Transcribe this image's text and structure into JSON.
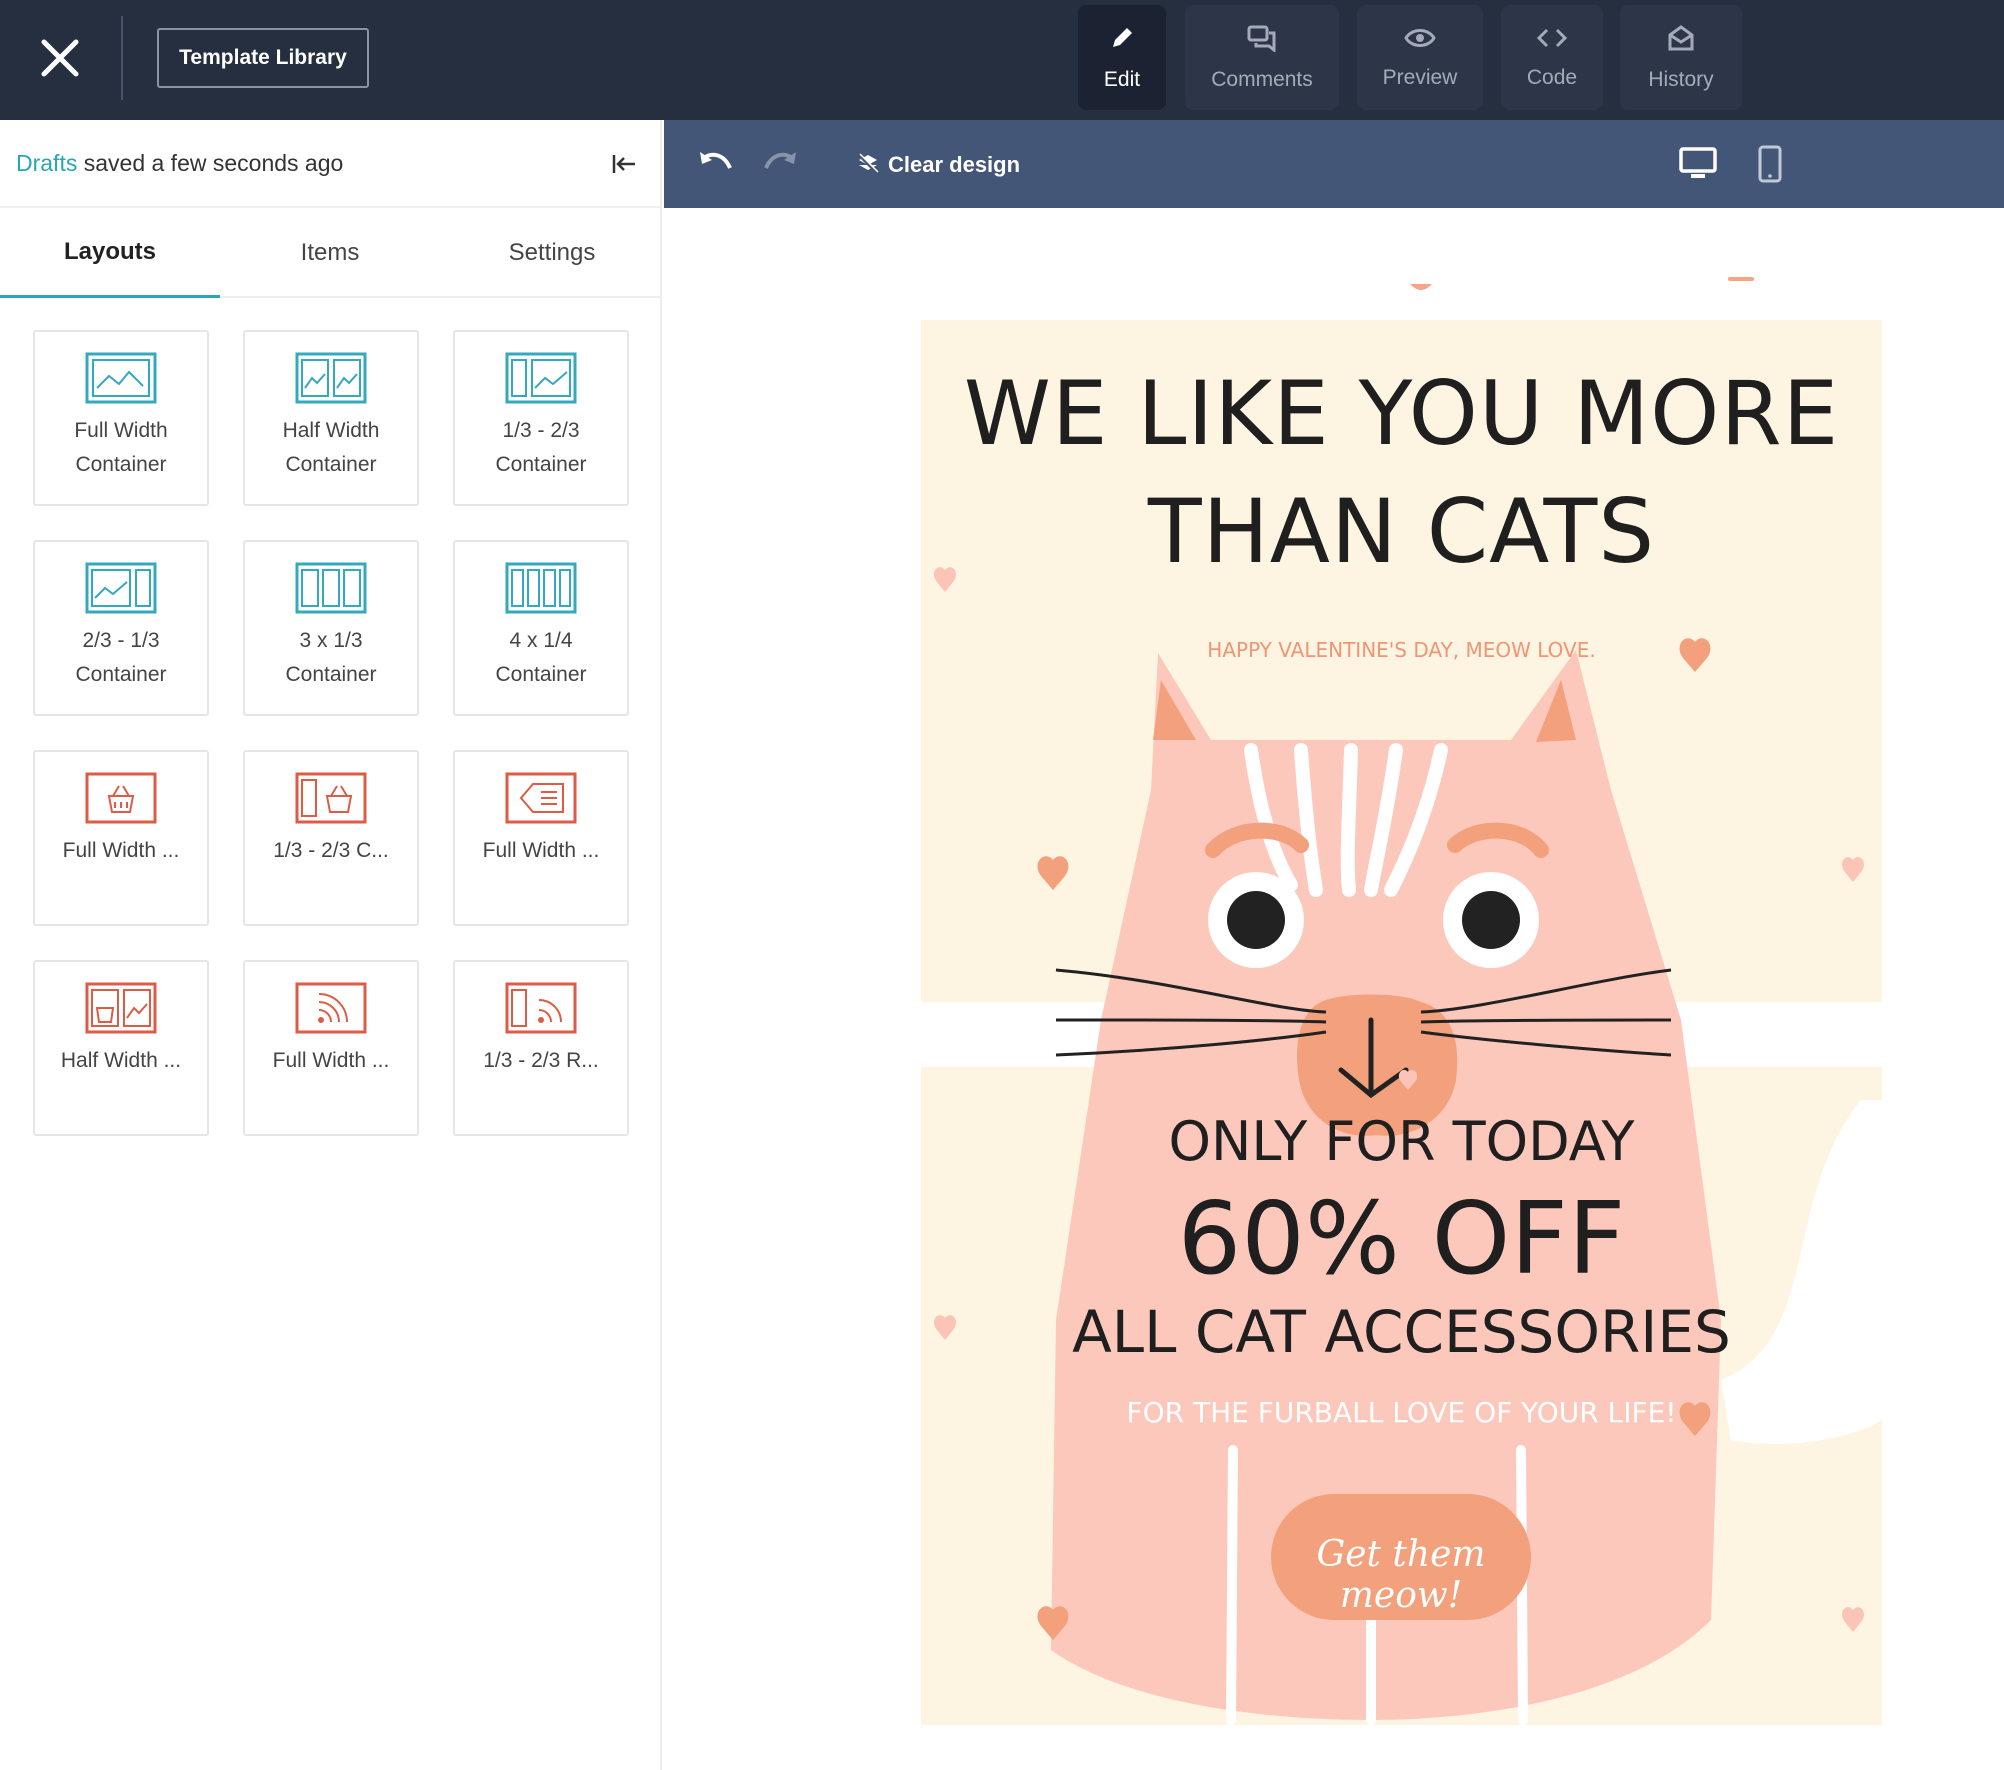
{
  "topbar": {
    "template_library_label": "Template Library",
    "modes": [
      {
        "label": "Edit",
        "icon": "pencil-icon",
        "active": true
      },
      {
        "label": "Comments",
        "icon": "comments-icon",
        "active": false
      },
      {
        "label": "Preview",
        "icon": "eye-icon",
        "active": false
      },
      {
        "label": "Code",
        "icon": "code-icon",
        "active": false
      },
      {
        "label": "History",
        "icon": "history-icon",
        "active": false
      }
    ]
  },
  "status": {
    "link": "Drafts",
    "text": "saved a few seconds ago"
  },
  "tabs": [
    {
      "label": "Layouts",
      "active": true
    },
    {
      "label": "Items",
      "active": false
    },
    {
      "label": "Settings",
      "active": false
    }
  ],
  "layouts": [
    {
      "label": "Full Width\nContainer",
      "icon": "full-width-container-icon"
    },
    {
      "label": "Half Width\nContainer",
      "icon": "half-width-container-icon"
    },
    {
      "label": "1/3 - 2/3\nContainer",
      "icon": "one-third-two-thirds-container-icon"
    },
    {
      "label": "2/3 - 1/3\nContainer",
      "icon": "two-thirds-one-third-container-icon"
    },
    {
      "label": "3 x 1/3\nContainer",
      "icon": "three-column-container-icon"
    },
    {
      "label": "4 x 1/4\nContainer",
      "icon": "four-column-container-icon"
    },
    {
      "label": "Full Width ...",
      "icon": "full-width-product-icon"
    },
    {
      "label": "1/3 - 2/3 C...",
      "icon": "one-third-product-icon"
    },
    {
      "label": "Full Width ...",
      "icon": "full-width-coupon-icon"
    },
    {
      "label": "Half Width ...",
      "icon": "half-width-product-icon"
    },
    {
      "label": "Full Width ...",
      "icon": "full-width-rss-icon"
    },
    {
      "label": "1/3 - 2/3 R...",
      "icon": "one-third-rss-icon"
    }
  ],
  "editor": {
    "clear_design_label": "Clear design",
    "icons": [
      "undo-icon",
      "redo-icon",
      "clear-design-icon",
      "desktop-view-icon",
      "mobile-view-icon"
    ]
  },
  "poster": {
    "headline_line1": "WE LIKE YOU MORE",
    "headline_line2": "THAN CATS",
    "subtitle": "HAPPY VALENTINE'S DAY, MEOW LOVE.",
    "offer_line1": "ONLY FOR TODAY",
    "offer_line2": "60% OFF",
    "offer_line3": "ALL CAT ACCESSORIES",
    "offer_line4": "FOR THE FURBALL LOVE OF YOUR LIFE!",
    "cta": "Get them meow!",
    "colors": {
      "background": "#fdf5e1",
      "cat": "#fdc8bc",
      "accent": "#f3a07c",
      "text": "#1f1f1f"
    }
  }
}
